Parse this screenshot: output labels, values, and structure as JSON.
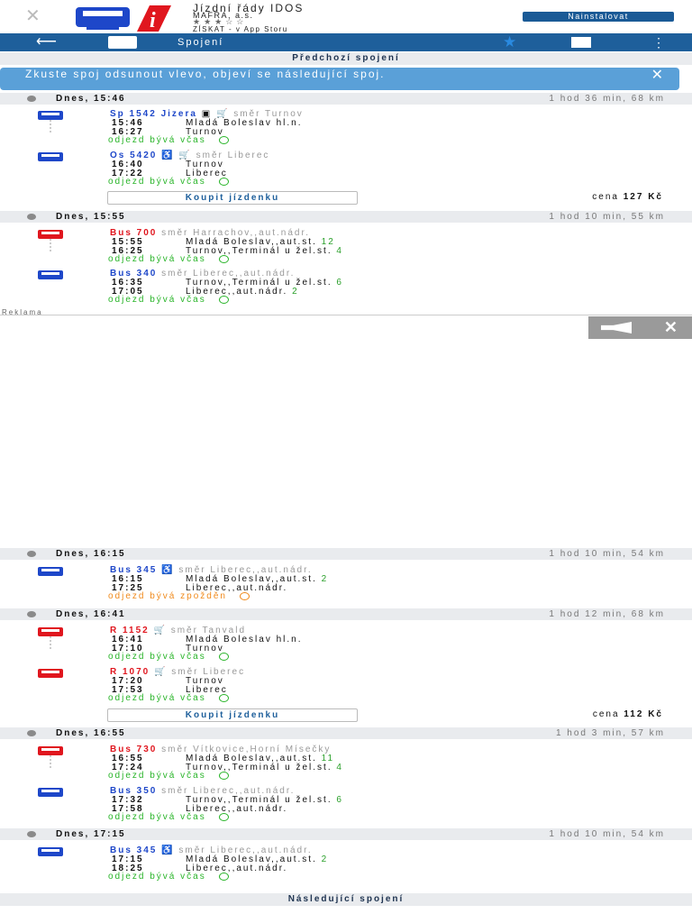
{
  "banner": {
    "app_name": "Jízdní řády IDOS",
    "publisher": "MAFRA, a.s.",
    "rating_stars": "★★★☆☆",
    "get_text": "ZÍSKAT - v App Storu",
    "install_label": "Nainstalovat"
  },
  "topbar": {
    "title": "Spojení"
  },
  "prev_label": "Předchozí spojení",
  "hint": {
    "text": "Zkuste spoj odsunout vlevo, objeví se následující spoj."
  },
  "groups": [
    {
      "time": "Dnes, 15:46",
      "duration": "1 hod 36 min, 68 km",
      "buy_label": "Koupit jízdenku",
      "price_label": "cena",
      "price_value": "127 Kč"
    },
    {
      "time": "Dnes, 15:55",
      "duration": "1 hod 10 min, 55 km"
    },
    {
      "time": "Dnes, 16:15",
      "duration": "1 hod 10 min, 54 km"
    },
    {
      "time": "Dnes, 16:41",
      "duration": "1 hod 12 min, 68 km",
      "buy_label": "Koupit jízdenku",
      "price_label": "cena",
      "price_value": "112 Kč"
    },
    {
      "time": "Dnes, 16:55",
      "duration": "1 hod 3 min, 57 km"
    },
    {
      "time": "Dnes, 17:15",
      "duration": "1 hod 10 min, 54 km"
    }
  ],
  "legs": [
    {
      "train": "Sp 1542 Jizera",
      "extras": "▣ 🛒",
      "direction": "směr Turnov",
      "dep_time": "15:46",
      "dep_stop": "Mladá Boleslav hl.n.",
      "dep_platform": "",
      "arr_time": "16:27",
      "arr_stop": "Turnov",
      "arr_platform": "",
      "status": "odjezd bývá včas"
    },
    {
      "train": "Os 5420",
      "extras": "♿ 🛒",
      "direction": "směr Liberec",
      "dep_time": "16:40",
      "dep_stop": "Turnov",
      "dep_platform": "",
      "arr_time": "17:22",
      "arr_stop": "Liberec",
      "arr_platform": "",
      "status": "odjezd bývá včas"
    },
    {
      "train": "Bus 700",
      "extras": "",
      "direction": "směr Harrachov,,aut.nádr.",
      "dep_time": "15:55",
      "dep_stop": "Mladá Boleslav,,aut.st.",
      "dep_platform": "12",
      "arr_time": "16:25",
      "arr_stop": "Turnov,,Terminál u žel.st.",
      "arr_platform": "4",
      "status": "odjezd bývá včas"
    },
    {
      "train": "Bus 340",
      "extras": "",
      "direction": "směr Liberec,,aut.nádr.",
      "dep_time": "16:35",
      "dep_stop": "Turnov,,Terminál u žel.st.",
      "dep_platform": "6",
      "arr_time": "17:05",
      "arr_stop": "Liberec,,aut.nádr.",
      "arr_platform": "2",
      "status": "odjezd bývá včas"
    },
    {
      "train": "Bus 345",
      "extras": "♿",
      "direction": "směr Liberec,,aut.nádr.",
      "dep_time": "16:15",
      "dep_stop": "Mladá Boleslav,,aut.st.",
      "dep_platform": "2",
      "arr_time": "17:25",
      "arr_stop": "Liberec,,aut.nádr.",
      "arr_platform": "",
      "status": "odjezd bývá zpožděn"
    },
    {
      "train": "R 1152",
      "extras": "🛒",
      "direction": "směr Tanvald",
      "dep_time": "16:41",
      "dep_stop": "Mladá Boleslav hl.n.",
      "dep_platform": "",
      "arr_time": "17:10",
      "arr_stop": "Turnov",
      "arr_platform": "",
      "status": "odjezd bývá včas"
    },
    {
      "train": "R 1070",
      "extras": "🛒",
      "direction": "směr Liberec",
      "dep_time": "17:20",
      "dep_stop": "Turnov",
      "dep_platform": "",
      "arr_time": "17:53",
      "arr_stop": "Liberec",
      "arr_platform": "",
      "status": "odjezd bývá včas"
    },
    {
      "train": "Bus 730",
      "extras": "",
      "direction": "směr Vítkovice,Horní Mísečky",
      "dep_time": "16:55",
      "dep_stop": "Mladá Boleslav,,aut.st.",
      "dep_platform": "11",
      "arr_time": "17:24",
      "arr_stop": "Turnov,,Terminál u žel.st.",
      "arr_platform": "4",
      "status": "odjezd bývá včas"
    },
    {
      "train": "Bus 350",
      "extras": "",
      "direction": "směr Liberec,,aut.nádr.",
      "dep_time": "17:32",
      "dep_stop": "Turnov,,Terminál u žel.st.",
      "dep_platform": "6",
      "arr_time": "17:58",
      "arr_stop": "Liberec,,aut.nádr.",
      "arr_platform": "",
      "status": "odjezd bývá včas"
    },
    {
      "train": "Bus 345",
      "extras": "♿",
      "direction": "směr Liberec,,aut.nádr.",
      "dep_time": "17:15",
      "dep_stop": "Mladá Boleslav,,aut.st.",
      "dep_platform": "2",
      "arr_time": "18:25",
      "arr_stop": "Liberec,,aut.nádr.",
      "arr_platform": "",
      "status": "odjezd bývá včas"
    }
  ],
  "ad": {
    "label": "Reklama"
  },
  "next_label": "Následující spojení",
  "colors": {
    "brand": "#1e5f9b",
    "train_blue": "#1e47c9",
    "bus_red": "#e0161e",
    "ontime": "#28b428",
    "late": "#f08a1c"
  }
}
